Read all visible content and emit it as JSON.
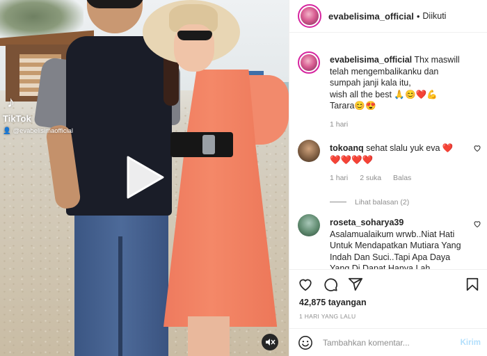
{
  "video": {
    "watermark_brand": "TikTok",
    "watermark_handle": "@evabelisimaofficial",
    "logo_icon": "tiktok-logo-icon",
    "play_icon": "play-icon",
    "mute_icon": "sound-off-icon"
  },
  "header": {
    "username": "evabelisima_official",
    "separator": "•",
    "follow_status": "Diikuti"
  },
  "caption": {
    "username": "evabelisima_official",
    "line1": " Thx maswill telah mengembalikanku dan sumpah janji kala itu,",
    "line2": "wish all the best 🙏😊❤️💪",
    "line3": "Tarara😊😍",
    "time": "1 hari"
  },
  "comments": [
    {
      "username": "tokoanq",
      "text": " sehat slalu yuk eva ❤️",
      "text2": "❤️❤️❤️❤️",
      "time": "1 hari",
      "likes": "2 suka",
      "reply": "Balas",
      "view_replies": "Lihat balasan (2)"
    },
    {
      "username": "roseta_soharya39",
      "text": "Asalamualaikum wrwb..Niat Hati Untuk Mendapatkan Mutiara Yang Indah Dan Suci..Tapi Apa Daya Yang Di Dapat Hanya Lah"
    }
  ],
  "stats": {
    "views": "42,875 tayangan",
    "posted": "1 HARI YANG LALU"
  },
  "composer": {
    "placeholder": "Tambahkan komentar...",
    "send": "Kirim"
  },
  "colors": {
    "accent": "#0095f6",
    "send_disabled": "#b2dffc",
    "heart": "#ed4956",
    "muted_text": "#8e8e8e"
  }
}
